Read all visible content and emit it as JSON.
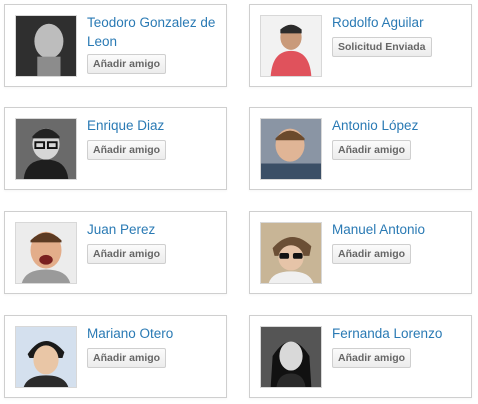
{
  "cards": [
    {
      "name": "Teodoro Gonzalez de Leon",
      "action": "Añadir amigo",
      "avatar_icon": "person-icon"
    },
    {
      "name": "Rodolfo Aguilar",
      "action": "Solicitud Enviada",
      "avatar_icon": "person-icon"
    },
    {
      "name": "Enrique Diaz",
      "action": "Añadir amigo",
      "avatar_icon": "person-icon"
    },
    {
      "name": "Antonio López",
      "action": "Añadir amigo",
      "avatar_icon": "person-icon"
    },
    {
      "name": "Juan Perez",
      "action": "Añadir amigo",
      "avatar_icon": "person-icon"
    },
    {
      "name": "Manuel Antonio",
      "action": "Añadir amigo",
      "avatar_icon": "person-icon"
    },
    {
      "name": "Mariano Otero",
      "action": "Añadir amigo",
      "avatar_icon": "person-icon"
    },
    {
      "name": "Fernanda Lorenzo",
      "action": "Añadir amigo",
      "avatar_icon": "person-icon"
    }
  ],
  "colors": {
    "name_link": "#2a7ab4",
    "card_border": "#cfcfcf",
    "button_text": "#666666"
  }
}
